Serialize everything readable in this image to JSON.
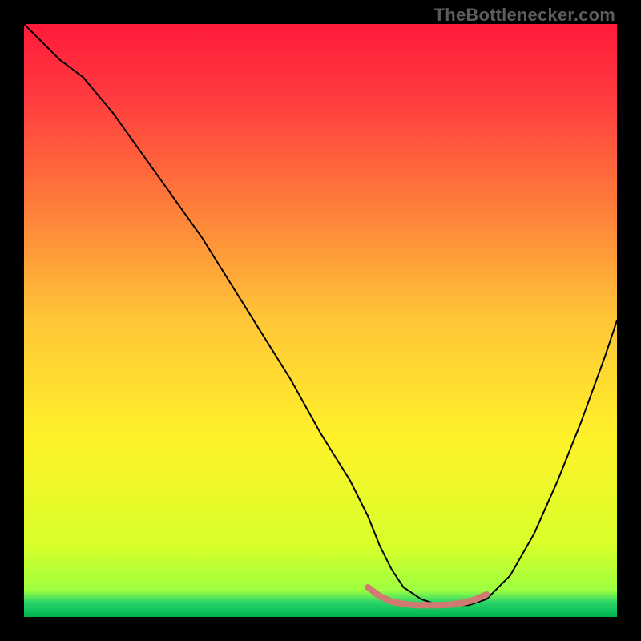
{
  "watermark": "TheBottlenecker.com",
  "chart_data": {
    "type": "line",
    "title": "",
    "xlabel": "",
    "ylabel": "",
    "xlim": [
      0,
      100
    ],
    "ylim": [
      0,
      100
    ],
    "background": {
      "type": "vertical-gradient",
      "stops": [
        {
          "offset": 0.0,
          "color": "#ff1a3a"
        },
        {
          "offset": 0.12,
          "color": "#ff3a3f"
        },
        {
          "offset": 0.3,
          "color": "#ff7a3a"
        },
        {
          "offset": 0.5,
          "color": "#ffc637"
        },
        {
          "offset": 0.7,
          "color": "#fff22a"
        },
        {
          "offset": 0.88,
          "color": "#d8ff2a"
        },
        {
          "offset": 0.955,
          "color": "#9dff3f"
        },
        {
          "offset": 0.975,
          "color": "#2bd66a"
        },
        {
          "offset": 1.0,
          "color": "#00b34f"
        }
      ]
    },
    "series": [
      {
        "name": "bottleneck-curve",
        "color": "#000000",
        "width": 2,
        "x": [
          0,
          3,
          6,
          10,
          15,
          20,
          25,
          30,
          35,
          40,
          45,
          50,
          55,
          58,
          60,
          62,
          64,
          67,
          70,
          73,
          75,
          78,
          82,
          86,
          90,
          94,
          98,
          100
        ],
        "y": [
          100,
          97,
          94,
          91,
          85,
          78,
          71,
          64,
          56,
          48,
          40,
          31,
          23,
          17,
          12,
          8,
          5,
          3,
          2,
          2,
          2,
          3,
          7,
          14,
          23,
          33,
          44,
          50
        ]
      },
      {
        "name": "optimal-range-marker",
        "color": "#d07a72",
        "width": 8,
        "x": [
          58,
          60,
          62,
          64,
          66,
          68,
          70,
          72,
          74,
          76,
          78
        ],
        "y": [
          5,
          3.5,
          2.6,
          2.2,
          2.0,
          2.0,
          2.0,
          2.1,
          2.4,
          2.9,
          3.8
        ]
      }
    ]
  }
}
